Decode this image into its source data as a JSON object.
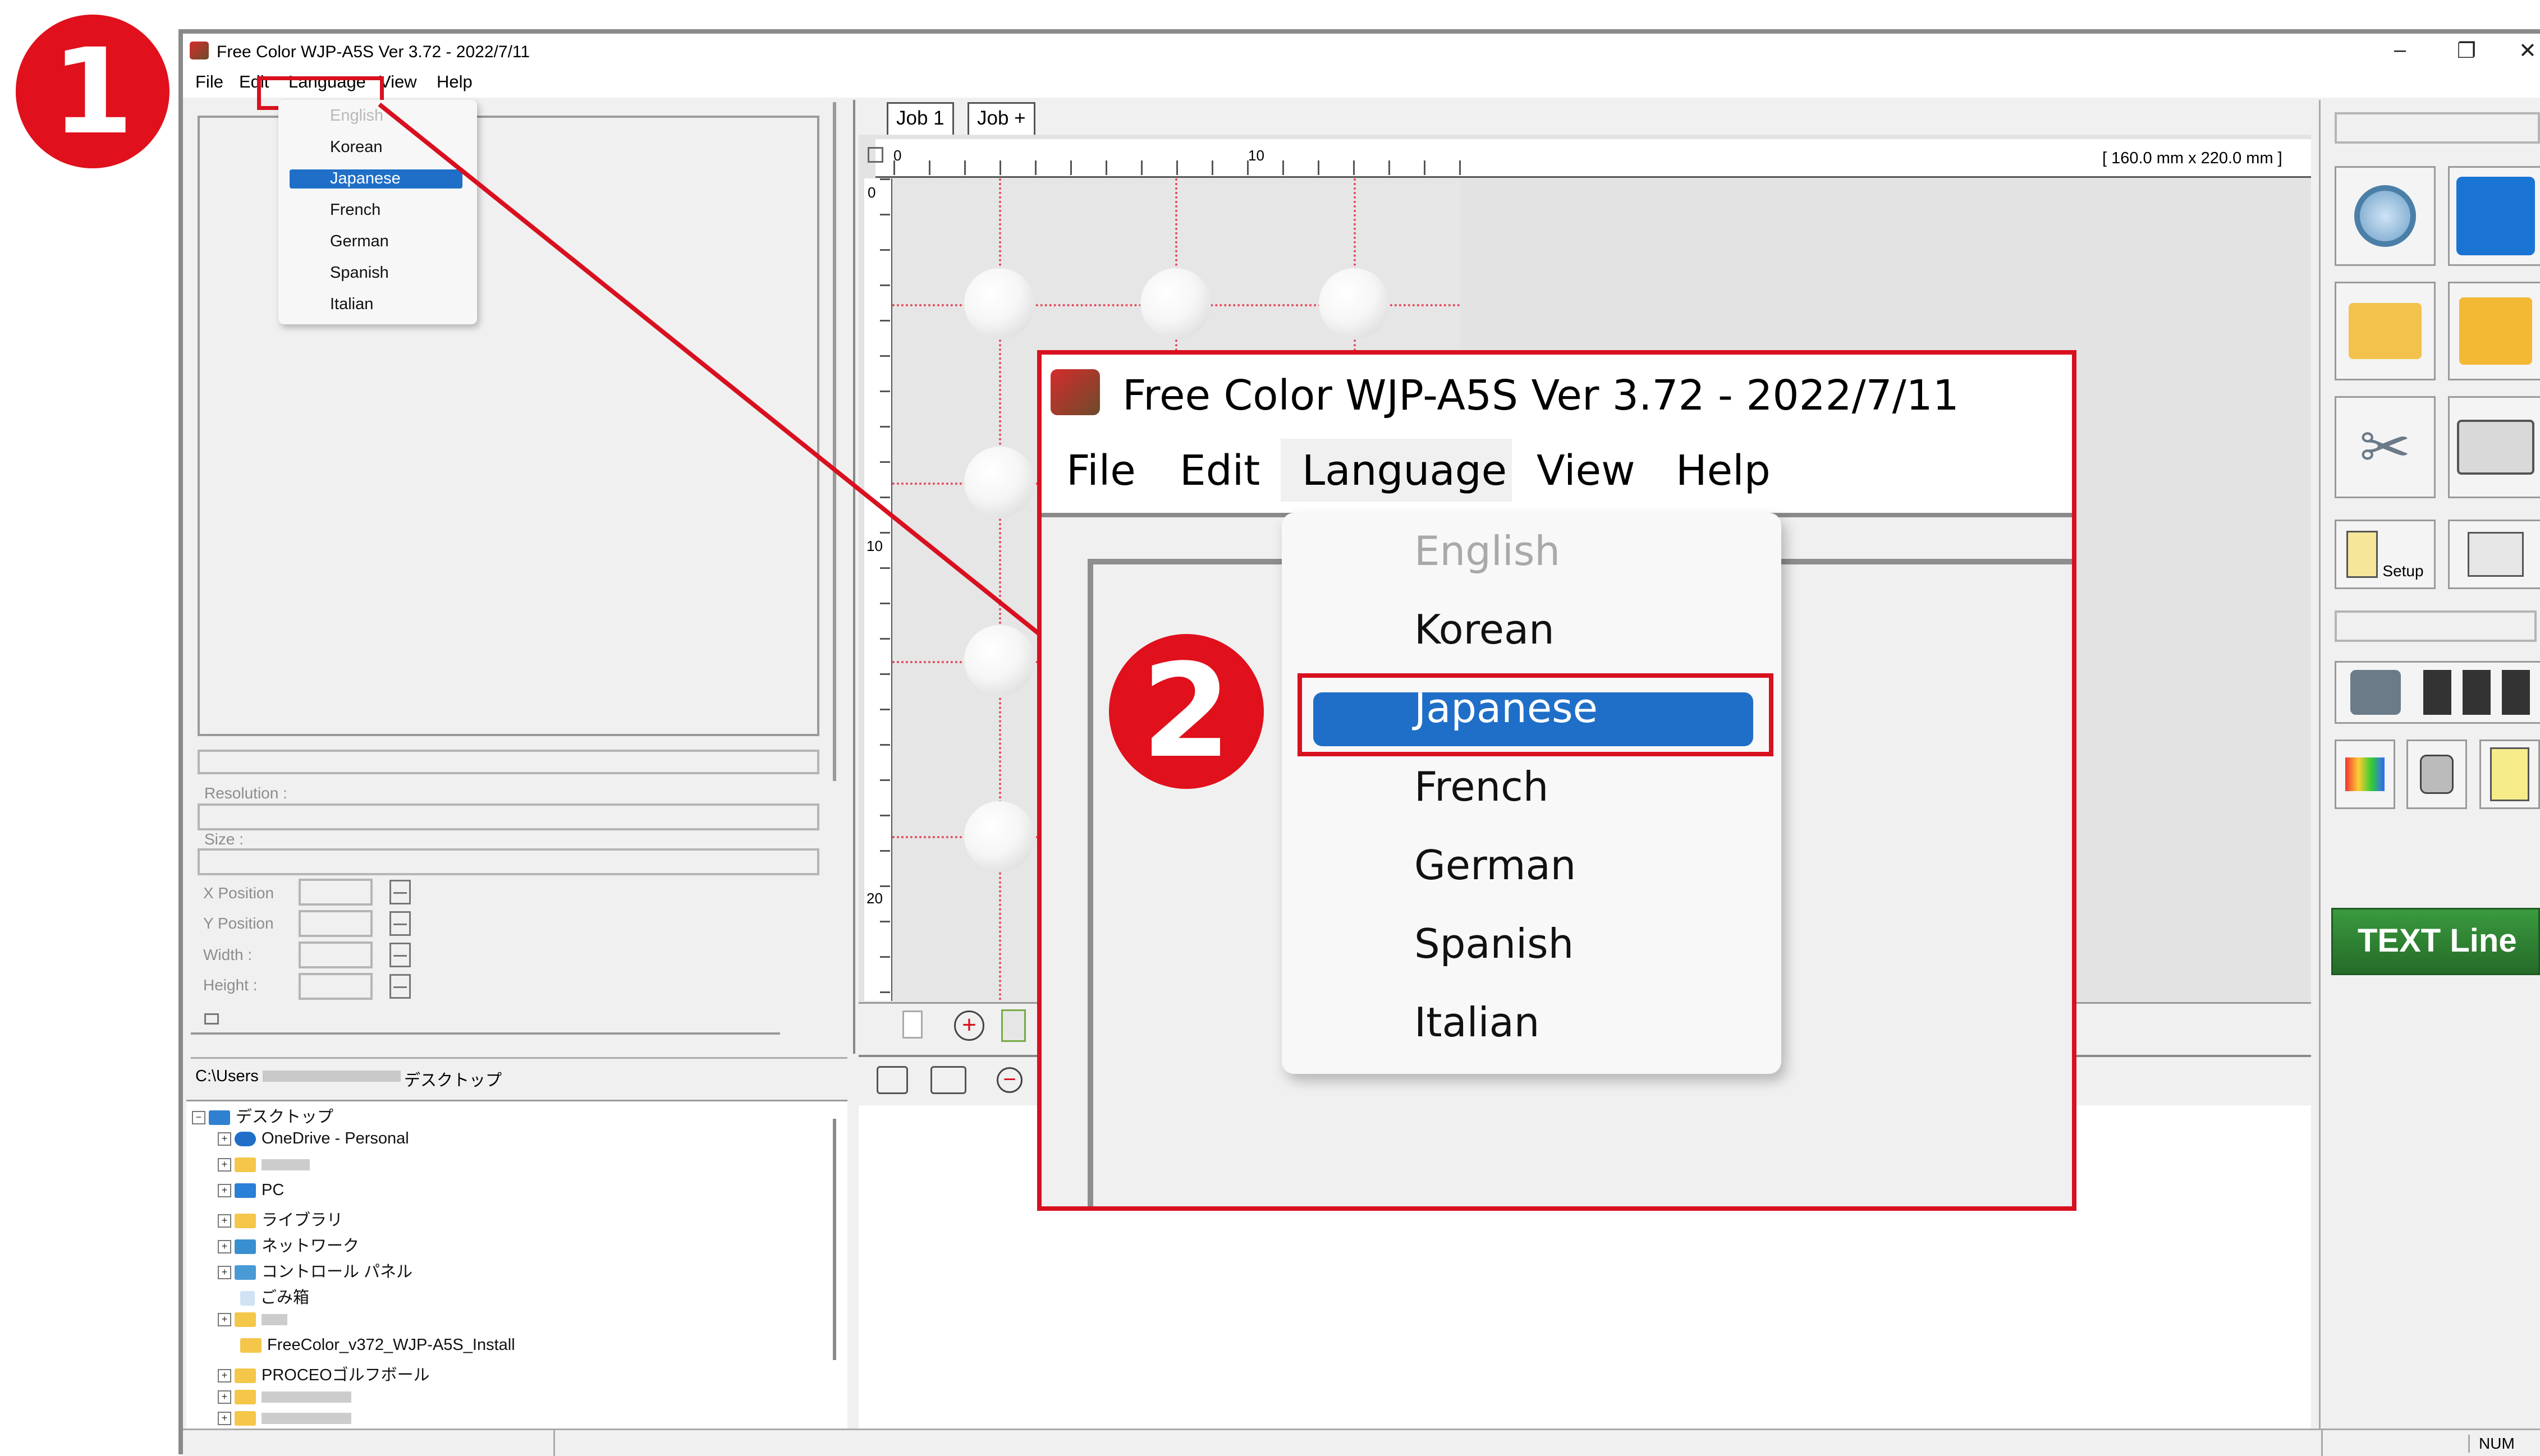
{
  "steps": {
    "one": "1",
    "two": "2"
  },
  "window": {
    "title": "Free Color WJP-A5S Ver 3.72 - 2022/7/11",
    "controls": {
      "minimize": "–",
      "restore": "❐",
      "close": "✕"
    }
  },
  "menubar": {
    "file": "File",
    "edit": "Edit",
    "language": "Language",
    "view": "View",
    "help": "Help"
  },
  "language_menu": {
    "items": [
      "English",
      "Korean",
      "Japanese",
      "French",
      "German",
      "Spanish",
      "Italian"
    ],
    "disabled": "English",
    "selected": "Japanese"
  },
  "properties": {
    "resolution_label": "Resolution :",
    "size_label": "Size :",
    "x_position_label": "X Position",
    "y_position_label": "Y Position",
    "width_label": "Width :",
    "height_label": "Height :"
  },
  "tabs": {
    "job1": "Job 1",
    "jobplus": "Job +"
  },
  "ruler": {
    "dimension": "[ 160.0 mm x 220.0 mm ]",
    "h_ticks": [
      "0",
      "10"
    ],
    "v_ticks": [
      "0",
      "10",
      "20"
    ]
  },
  "explorer": {
    "path": "C:\\Users",
    "path_suffix": "デスクトップ",
    "tree": [
      "デスクトップ",
      "OneDrive - Personal",
      "PC",
      "ライブラリ",
      "ネットワーク",
      "コントロール パネル",
      "ごみ箱",
      "FreeColor_v372_WJP-A5S_Install",
      "PROCEOゴルフボール"
    ]
  },
  "toolbar": {
    "setup_label": "Setup",
    "text_line_label": "TEXT Line"
  },
  "status": {
    "num": "NUM"
  },
  "colors": {
    "accent_red": "#e0101c",
    "selection_blue": "#1f6fc8",
    "text_line_green": "#2f7d32"
  }
}
